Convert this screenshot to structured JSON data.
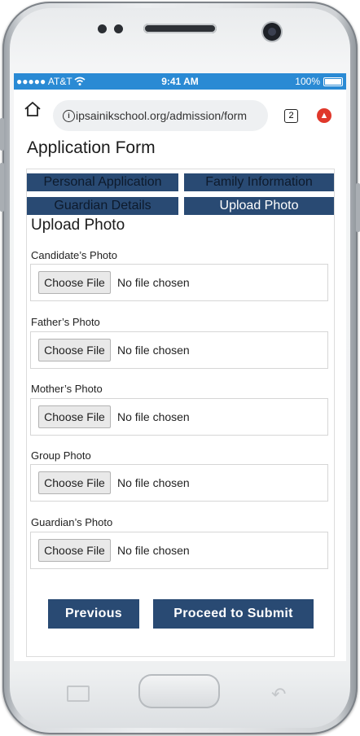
{
  "statusbar": {
    "carrier": "●●●●● AT&T",
    "time": "9:41 AM",
    "battery": "100%"
  },
  "browser": {
    "url": "ipsainikschool.org/admission/form",
    "tab_count": "2"
  },
  "page": {
    "title": "Application Form"
  },
  "tabs": [
    {
      "label": "Personal Application",
      "active": false
    },
    {
      "label": "Family Information",
      "active": false
    },
    {
      "label": "Guardian Details",
      "active": false
    },
    {
      "label": "Upload Photo",
      "active": true
    }
  ],
  "section": {
    "title": "Upload Photo"
  },
  "fields": [
    {
      "label": "Candidate’s Photo",
      "button": "Choose File",
      "status": "No file chosen"
    },
    {
      "label": "Father’s Photo",
      "button": "Choose File",
      "status": "No file chosen"
    },
    {
      "label": "Mother’s Photo",
      "button": "Choose File",
      "status": "No file chosen"
    },
    {
      "label": "Group Photo",
      "button": "Choose File",
      "status": "No file chosen"
    },
    {
      "label": "Guardian’s Photo",
      "button": "Choose File",
      "status": "No file chosen"
    }
  ],
  "actions": {
    "previous": "Previous",
    "submit": "Proceed to Submit"
  },
  "colors": {
    "accent": "#294a73",
    "statusbar": "#2a8ad4",
    "menu": "#e0382b"
  },
  "icons": [
    "home-icon",
    "info-icon",
    "tab-count-icon",
    "menu-icon",
    "wifi-icon",
    "battery-icon"
  ]
}
